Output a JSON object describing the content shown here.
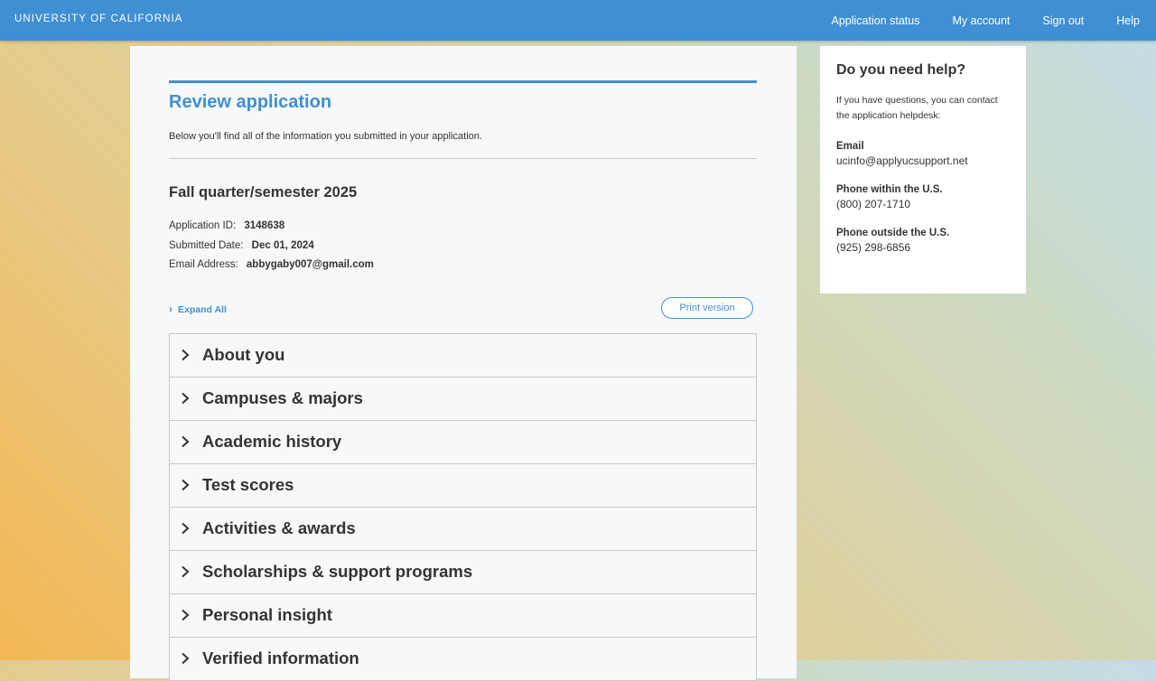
{
  "header": {
    "brand": "UNIVERSITY OF CALIFORNIA",
    "nav": [
      "Application status",
      "My account",
      "Sign out",
      "Help"
    ]
  },
  "main": {
    "title": "Review application",
    "intro": "Below you'll find all of the information you submitted in your application.",
    "term": "Fall quarter/semester 2025",
    "application_id_label": "Application ID:",
    "application_id": "3148638",
    "submitted_label": "Submitted Date:",
    "submitted_date": "Dec 01, 2024",
    "email_label": "Email Address:",
    "email": "abbygaby007@gmail.com",
    "expand_all": "Expand All",
    "print_version": "Print version",
    "sections": [
      "About you",
      "Campuses & majors",
      "Academic history",
      "Test scores",
      "Activities & awards",
      "Scholarships & support programs",
      "Personal insight",
      "Verified information"
    ]
  },
  "help": {
    "title": "Do you need help?",
    "text": "If you have questions, you can contact the application helpdesk:",
    "email_label": "Email",
    "email": "ucinfo@applyucsupport.net",
    "phone_us_label": "Phone within the U.S.",
    "phone_us": "(800) 207-1710",
    "phone_intl_label": "Phone outside the U.S.",
    "phone_intl": "(925) 298-6856"
  }
}
